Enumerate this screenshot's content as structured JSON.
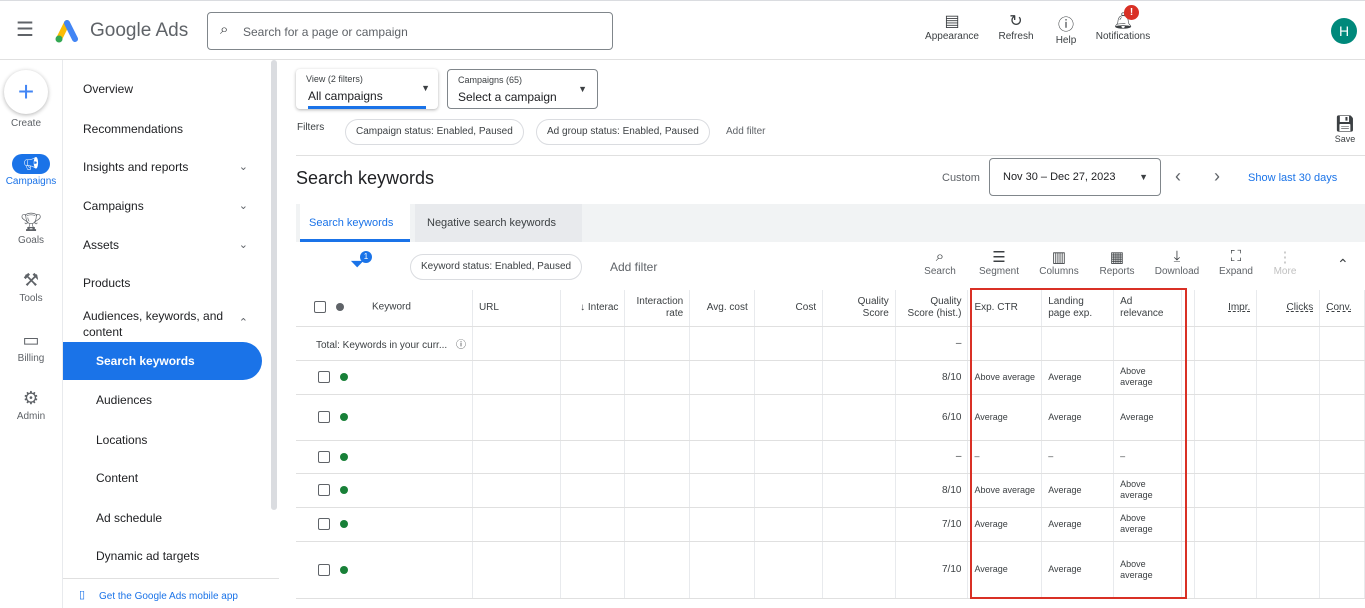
{
  "header": {
    "brand": "Google Ads",
    "search_placeholder": "Search for a page or campaign",
    "actions": [
      {
        "label": "Appearance",
        "icon": "appearance-icon"
      },
      {
        "label": "Refresh",
        "icon": "refresh-icon"
      },
      {
        "label": "Help",
        "icon": "help-icon"
      },
      {
        "label": "Notifications",
        "icon": "bell-icon"
      }
    ],
    "notification_badge": "!",
    "avatar": "H"
  },
  "rail": [
    {
      "label": "Create"
    },
    {
      "label": "Campaigns"
    },
    {
      "label": "Goals"
    },
    {
      "label": "Tools"
    },
    {
      "label": "Billing"
    },
    {
      "label": "Admin"
    }
  ],
  "nav": {
    "items": [
      "Overview",
      "Recommendations",
      "Insights and reports",
      "Campaigns",
      "Assets",
      "Products",
      "Audiences, keywords, and content"
    ],
    "sub": [
      "Search keywords",
      "Audiences",
      "Locations",
      "Content",
      "Ad schedule",
      "Dynamic ad targets"
    ],
    "app_link": "Get the Google Ads mobile app"
  },
  "view": {
    "label": "View (2 filters)",
    "value": "All campaigns"
  },
  "campaigns": {
    "label": "Campaigns (65)",
    "value": "Select a campaign"
  },
  "filters": {
    "label": "Filters",
    "chips": [
      "Campaign status: Enabled, Paused",
      "Ad group status: Enabled, Paused"
    ],
    "add": "Add filter"
  },
  "save": "Save",
  "page": {
    "title": "Search keywords",
    "date_label": "Custom",
    "date_range": "Nov 30 – Dec 27, 2023",
    "show_last": "Show last 30 days"
  },
  "tabs": [
    "Search keywords",
    "Negative search keywords"
  ],
  "toolbar": {
    "filter_badge": "1",
    "chip": "Keyword status: Enabled, Paused",
    "add_filter": "Add filter",
    "tools": [
      "Search",
      "Segment",
      "Columns",
      "Reports",
      "Download",
      "Expand",
      "More"
    ]
  },
  "table": {
    "columns": [
      "Keyword",
      "URL",
      "Interac",
      "Interaction rate",
      "Avg. cost",
      "Cost",
      "Quality Score",
      "Quality Score (hist.)",
      "Exp. CTR",
      "Landing page exp.",
      "Ad relevance",
      "",
      "Impr.",
      "Clicks",
      "Conv."
    ],
    "total": {
      "label": "Total: Keywords in your curr...",
      "qs_hist": "–"
    },
    "rows": [
      {
        "qs": "8/10",
        "ctr": "Above average",
        "lp": "Average",
        "rel": "Above average"
      },
      {
        "qs": "6/10",
        "ctr": "Average",
        "lp": "Average",
        "rel": "Average"
      },
      {
        "qs": "–",
        "ctr": "–",
        "lp": "–",
        "rel": "–"
      },
      {
        "qs": "8/10",
        "ctr": "Above average",
        "lp": "Average",
        "rel": "Above average"
      },
      {
        "qs": "7/10",
        "ctr": "Average",
        "lp": "Average",
        "rel": "Above average"
      },
      {
        "qs": "7/10",
        "ctr": "Average",
        "lp": "Average",
        "rel": "Above average"
      }
    ]
  },
  "colors": {
    "accent": "#1a73e8",
    "highlight": "#d93025",
    "enabled": "#188038"
  }
}
